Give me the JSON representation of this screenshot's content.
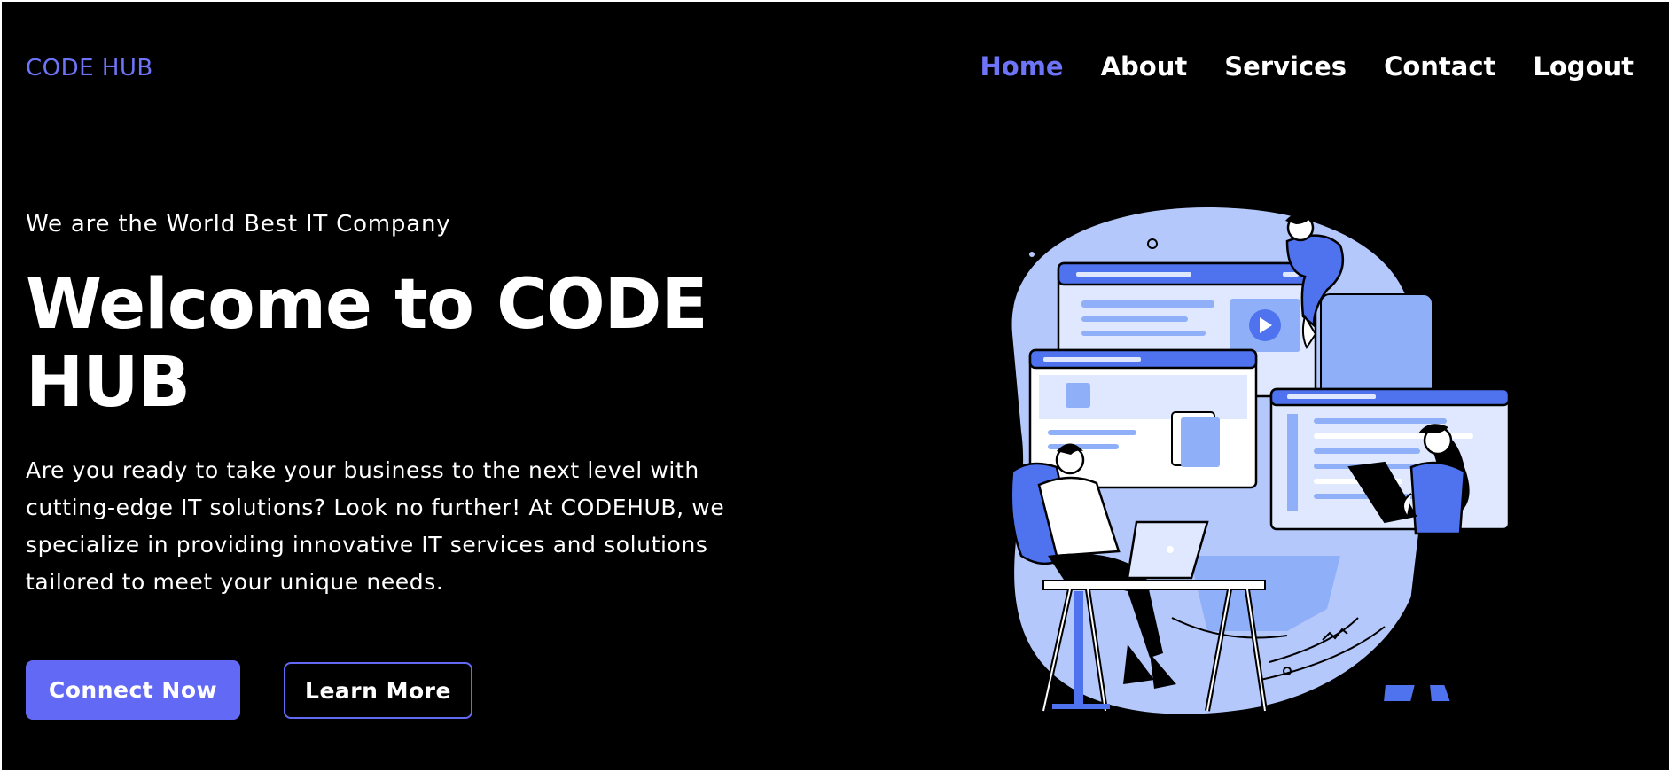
{
  "brand": {
    "logo_text": "CODE HUB"
  },
  "nav": {
    "items": [
      {
        "label": "Home",
        "active": true
      },
      {
        "label": "About",
        "active": false
      },
      {
        "label": "Services",
        "active": false
      },
      {
        "label": "Contact",
        "active": false
      },
      {
        "label": "Logout",
        "active": false
      }
    ]
  },
  "hero": {
    "tagline": "We are the World Best IT Company",
    "headline": "Welcome to CODE HUB",
    "description": "Are you ready to take your business to the next level with cutting-edge IT solutions? Look no further! At CODEHUB, we specialize in providing innovative IT services and solutions tailored to meet your unique needs.",
    "primary_button": "Connect Now",
    "secondary_button": "Learn More"
  },
  "colors": {
    "background": "#000000",
    "accent": "#6269f5",
    "accent_text": "#6d74f7",
    "illustration_light": "#b4c8fb",
    "illustration_mid": "#8fb0f8",
    "illustration_dark": "#4f72ee"
  },
  "icons": [
    "play-icon"
  ]
}
